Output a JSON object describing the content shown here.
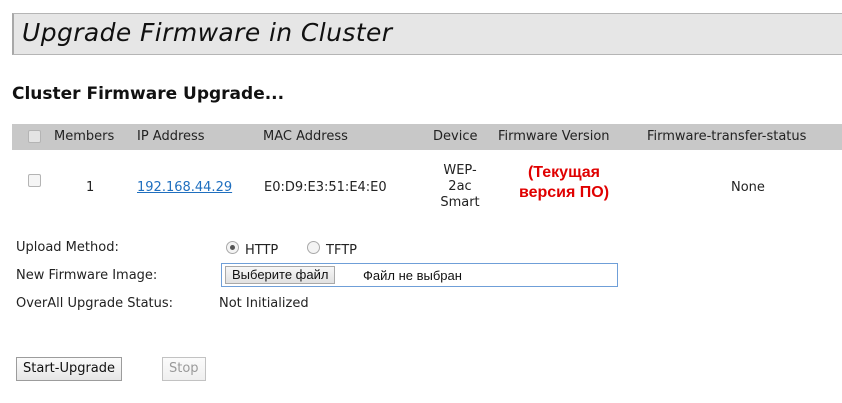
{
  "page": {
    "title": "Upgrade Firmware in Cluster"
  },
  "section": {
    "heading": "Cluster Firmware Upgrade..."
  },
  "table": {
    "headers": {
      "members": "Members",
      "ip": "IP Address",
      "mac": "MAC Address",
      "device": "Device",
      "firmware": "Firmware Version",
      "transfer": "Firmware-transfer-status"
    },
    "rows": [
      {
        "selected": false,
        "member": "1",
        "ip": "192.168.44.29",
        "mac": "E0:D9:E3:51:E4:E0",
        "device_lines": [
          "WEP-",
          "2ac",
          "Smart"
        ],
        "firmware_note_lines": [
          "(Текущая",
          "версия ПО)"
        ],
        "transfer_status": "None"
      }
    ]
  },
  "form": {
    "upload_method_label": "Upload Method:",
    "methods": [
      {
        "label": "HTTP",
        "selected": true
      },
      {
        "label": "TFTP",
        "selected": false
      }
    ],
    "image_label": "New Firmware Image:",
    "choose_file_label": "Выберите файл",
    "file_status": "Файл не выбран",
    "overall_status_label": "OverAll Upgrade Status:",
    "overall_status_value": "Not Initialized"
  },
  "buttons": {
    "start_label": "Start-Upgrade",
    "stop_label": "Stop",
    "stop_disabled": true
  },
  "colors": {
    "title_bar": "#e6e6e6",
    "table_header": "#c8c8c8",
    "link": "#1f6fbf",
    "annotation": "#e00000"
  }
}
